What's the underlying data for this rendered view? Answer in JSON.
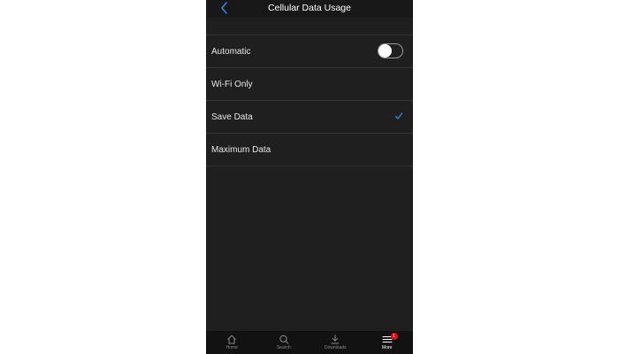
{
  "header": {
    "title": "Cellular Data Usage",
    "back_icon": "chevron-left-icon"
  },
  "options": [
    {
      "label": "Automatic",
      "control": "toggle",
      "toggle_on": false
    },
    {
      "label": "Wi-Fi Only",
      "control": "none"
    },
    {
      "label": "Save Data",
      "control": "checkmark",
      "selected": true
    },
    {
      "label": "Maximum Data",
      "control": "none"
    }
  ],
  "tabbar": {
    "tabs": [
      {
        "label": "Home",
        "icon": "home-icon"
      },
      {
        "label": "Search",
        "icon": "search-icon"
      },
      {
        "label": "Downloads",
        "icon": "download-icon"
      },
      {
        "label": "More",
        "icon": "menu-icon",
        "active": true,
        "badge": "1"
      }
    ]
  },
  "colors": {
    "background": "#1f1f1f",
    "accent": "#3d7ee8",
    "badge": "#e50914"
  }
}
